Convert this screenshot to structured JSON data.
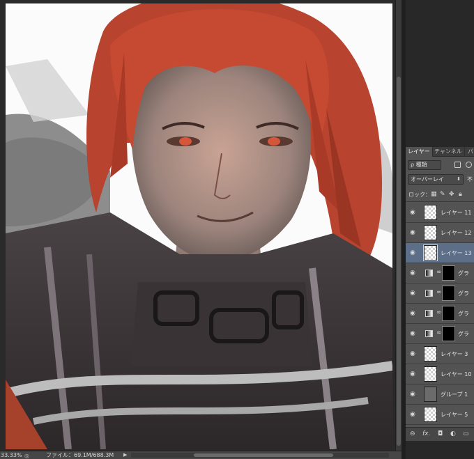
{
  "status_bar": {
    "zoom": "33.33%",
    "file_info": "ファイル：69.1M/688.3M",
    "arrow": "▶"
  },
  "layers_panel": {
    "tabs": [
      {
        "label": "レイヤー",
        "active": true
      },
      {
        "label": "チャンネル",
        "active": false
      },
      {
        "label": "パ",
        "active": false
      }
    ],
    "filter_kind": "ρ 種類",
    "blend_mode": "オーバーレイ",
    "opacity_label": "不",
    "lock_label": "ロック：",
    "layers": [
      {
        "name": "レイヤー 11",
        "kind": "pixel",
        "selected": false
      },
      {
        "name": "レイヤー 12",
        "kind": "pixel",
        "selected": false
      },
      {
        "name": "レイヤー 13",
        "kind": "pixel",
        "selected": true
      },
      {
        "name": "グラ",
        "kind": "gradient-mask",
        "selected": false
      },
      {
        "name": "グラ",
        "kind": "gradient-mask",
        "selected": false
      },
      {
        "name": "グラ",
        "kind": "gradient-mask",
        "selected": false
      },
      {
        "name": "グラ",
        "kind": "gradient-mask",
        "selected": false
      },
      {
        "name": "レイヤー 3",
        "kind": "pixel",
        "selected": false
      },
      {
        "name": "レイヤー 10",
        "kind": "pixel",
        "selected": false
      },
      {
        "name": "グループ 1",
        "kind": "group",
        "selected": false
      },
      {
        "name": "レイヤー 5",
        "kind": "pixel",
        "selected": false
      }
    ]
  },
  "colors": {
    "selected_layer": "#5d6f88",
    "panel_bg": "#535353",
    "hair": "#c8452c"
  }
}
